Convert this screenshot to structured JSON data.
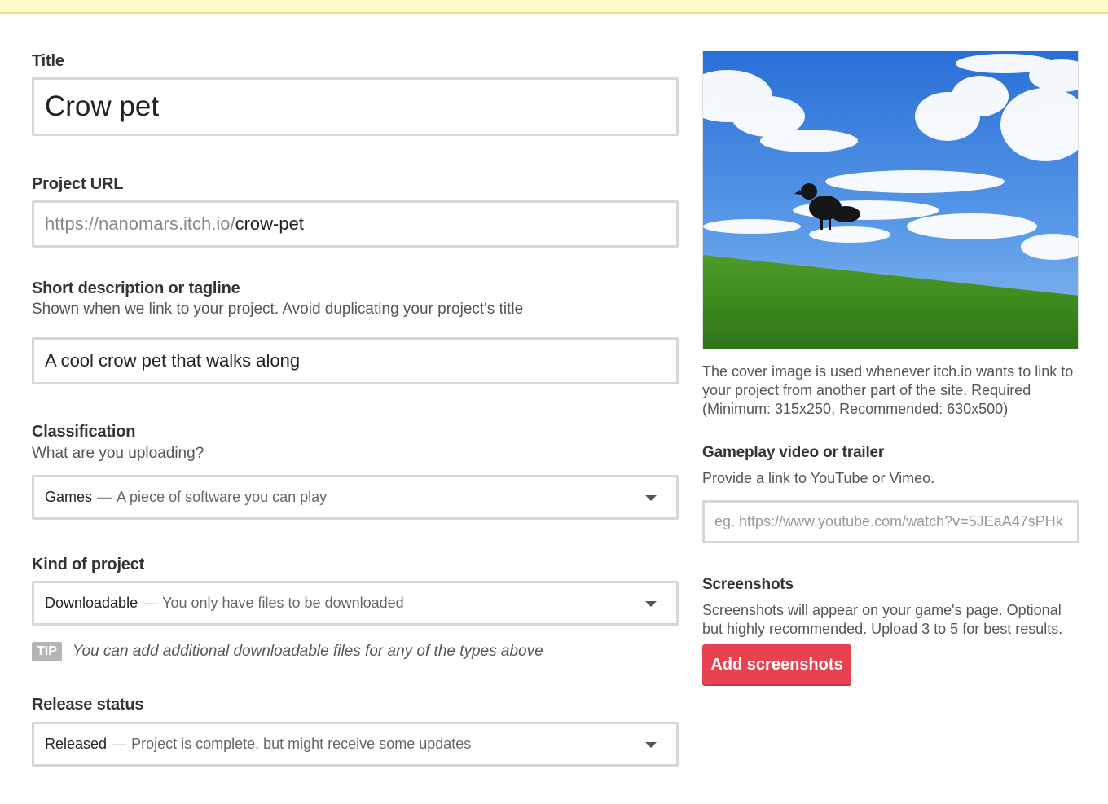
{
  "form": {
    "title_label": "Title",
    "title_value": "Crow pet",
    "url_label": "Project URL",
    "url_prefix": "https://nanomars.itch.io/",
    "url_slug": "crow-pet",
    "tagline_label": "Short description or tagline",
    "tagline_help": "Shown when we link to your project. Avoid duplicating your project's title",
    "tagline_value": "A cool crow pet that walks along",
    "classification_label": "Classification",
    "classification_help": "What are you uploading?",
    "classification_selected": "Games",
    "classification_desc": "A piece of software you can play",
    "kind_label": "Kind of project",
    "kind_selected": "Downloadable",
    "kind_desc": "You only have files to be downloaded",
    "tip_badge": "TIP",
    "tip_text": "You can add additional downloadable files for any of the types above",
    "release_label": "Release status",
    "release_selected": "Released",
    "release_desc": "Project is complete, but might receive some updates",
    "separator": "—"
  },
  "sidebar": {
    "cover_help": "The cover image is used whenever itch.io wants to link to your project from another part of the site. Required (Minimum: 315x250, Recommended: 630x500)",
    "video_label": "Gameplay video or trailer",
    "video_help": "Provide a link to YouTube or Vimeo.",
    "video_placeholder": "eg. https://www.youtube.com/watch?v=5JEaA47sPHk",
    "screenshots_label": "Screenshots",
    "screenshots_help": "Screenshots will appear on your game's page. Optional but highly recommended. Upload 3 to 5 for best results.",
    "add_screenshots_button": "Add screenshots"
  },
  "colors": {
    "accent": "#e84250",
    "notice_bg": "#fffbcc",
    "input_border": "#d7d7d7",
    "tip_badge": "#b5b5b5"
  },
  "icons": {
    "select_caret": "chevron-down-icon"
  }
}
